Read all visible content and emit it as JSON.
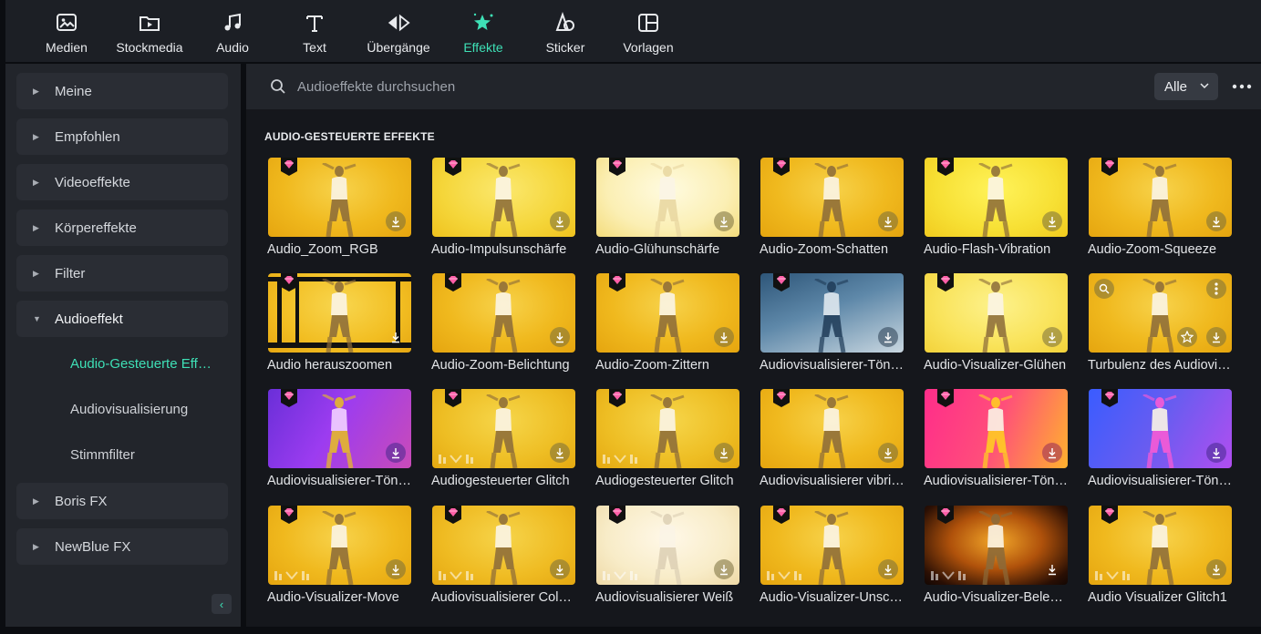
{
  "toolbar": {
    "tabs": [
      {
        "label": "Medien",
        "icon": "media-icon"
      },
      {
        "label": "Stockmedia",
        "icon": "stockmedia-icon"
      },
      {
        "label": "Audio",
        "icon": "music-note-icon"
      },
      {
        "label": "Text",
        "icon": "text-icon"
      },
      {
        "label": "Übergänge",
        "icon": "transitions-icon"
      },
      {
        "label": "Effekte",
        "icon": "effects-star-icon",
        "active": true
      },
      {
        "label": "Sticker",
        "icon": "sticker-icon"
      },
      {
        "label": "Vorlagen",
        "icon": "templates-icon"
      }
    ],
    "active_color": "#3ee0b6"
  },
  "sidebar": {
    "items": [
      {
        "label": "Meine",
        "expanded": false
      },
      {
        "label": "Empfohlen",
        "expanded": false
      },
      {
        "label": "Videoeffekte",
        "expanded": false
      },
      {
        "label": "Körpereffekte",
        "expanded": false
      },
      {
        "label": "Filter",
        "expanded": false
      },
      {
        "label": "Audioeffekt",
        "expanded": true
      },
      {
        "label": "Boris FX",
        "expanded": false
      },
      {
        "label": "NewBlue FX",
        "expanded": false
      }
    ],
    "subitems": [
      {
        "label": "Audio-Gesteuerte Effekte",
        "active": true
      },
      {
        "label": "Audiovisualisierung"
      },
      {
        "label": "Stimmfilter"
      }
    ]
  },
  "search": {
    "placeholder": "Audioeffekte durchsuchen",
    "value": ""
  },
  "filter": {
    "selected": "Alle"
  },
  "section": {
    "title": "AUDIO-GESTEUERTE EFFEKTE"
  },
  "effects": [
    {
      "label": "Audio_Zoom_RGB",
      "style": "yellow"
    },
    {
      "label": "Audio-Impulsunschärfe",
      "style": "yellow-light"
    },
    {
      "label": "Audio-Glühunschärfe",
      "style": "cream"
    },
    {
      "label": "Audio-Zoom-Schatten",
      "style": "yellow"
    },
    {
      "label": "Audio-Flash-Vibration",
      "style": "yellow-bright"
    },
    {
      "label": "Audio-Zoom-Squeeze",
      "style": "yellow"
    },
    {
      "label": "Audio herauszoomen",
      "style": "frame"
    },
    {
      "label": "Audio-Zoom-Belichtung",
      "style": "yellow"
    },
    {
      "label": "Audio-Zoom-Zittern",
      "style": "yellow"
    },
    {
      "label": "Audiovisualisierer-Tönung",
      "style": "blue-tint"
    },
    {
      "label": "Audio-Visualizer-Glühen",
      "style": "yellow-pale"
    },
    {
      "label": "Turbulenz des Audiovisualisierers",
      "style": "yellow",
      "hovered": true
    },
    {
      "label": "Audiovisualisierer-Tönung",
      "style": "purple"
    },
    {
      "label": "Audiogesteuerter Glitch",
      "style": "yellow-glitch"
    },
    {
      "label": "Audiogesteuerter Glitch",
      "style": "yellow-glitch"
    },
    {
      "label": "Audiovisualisierer vibrieren",
      "style": "yellow"
    },
    {
      "label": "Audiovisualisierer-Tönung",
      "style": "pink"
    },
    {
      "label": "Audiovisualisierer-Tönung",
      "style": "blue-pink"
    },
    {
      "label": "Audio-Visualizer-Move",
      "style": "yellow"
    },
    {
      "label": "Audiovisualisierer Colorful",
      "style": "yellow-color"
    },
    {
      "label": "Audiovisualisierer Weiß",
      "style": "cream-white"
    },
    {
      "label": "Audio-Visualizer-Unschärfe",
      "style": "yellow"
    },
    {
      "label": "Audio-Visualizer-Beleuchtung",
      "style": "dark-vignette"
    },
    {
      "label": "Audio Visualizer Glitch1",
      "style": "yellow"
    }
  ]
}
